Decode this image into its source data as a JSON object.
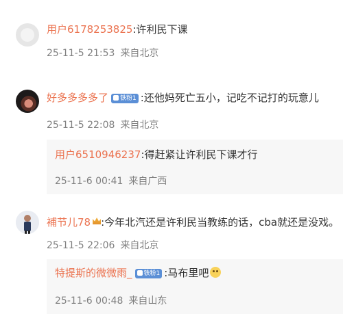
{
  "comments": [
    {
      "username": "用户6178253825",
      "separator": ":",
      "text": "许利民下课",
      "date": "25-11-5 21:53",
      "location": "来自北京",
      "avatar_icon": "default-avatar-icon"
    },
    {
      "username": "好多多多多了",
      "badge": "铁粉1",
      "separator": ":",
      "text": "还他妈死亡五小，记吃不记打的玩意儿",
      "date": "25-11-5 22:08",
      "location": "来自北京",
      "avatar_icon": "user-avatar-icon",
      "reply": {
        "username": "用户6510946237",
        "separator": ":",
        "text": "得赶紧让许利民下课才行",
        "date": "25-11-6 00:41",
        "location": "来自广西"
      }
    },
    {
      "username": "補节儿78",
      "crown_icon": "crown-icon",
      "separator": ":",
      "text": "今年北汽还是许利民当教练的话，cba就还是没戏。",
      "date": "25-11-5 22:06",
      "location": "来自北京",
      "avatar_icon": "user-avatar-icon",
      "reply": {
        "username": "特提斯的微微雨_",
        "badge": "铁粉1",
        "separator": ":",
        "text": "马布里吧",
        "emoji_icon": "smile-emoji-icon",
        "date": "25-11-6 00:48",
        "location": "来自山东"
      }
    }
  ]
}
